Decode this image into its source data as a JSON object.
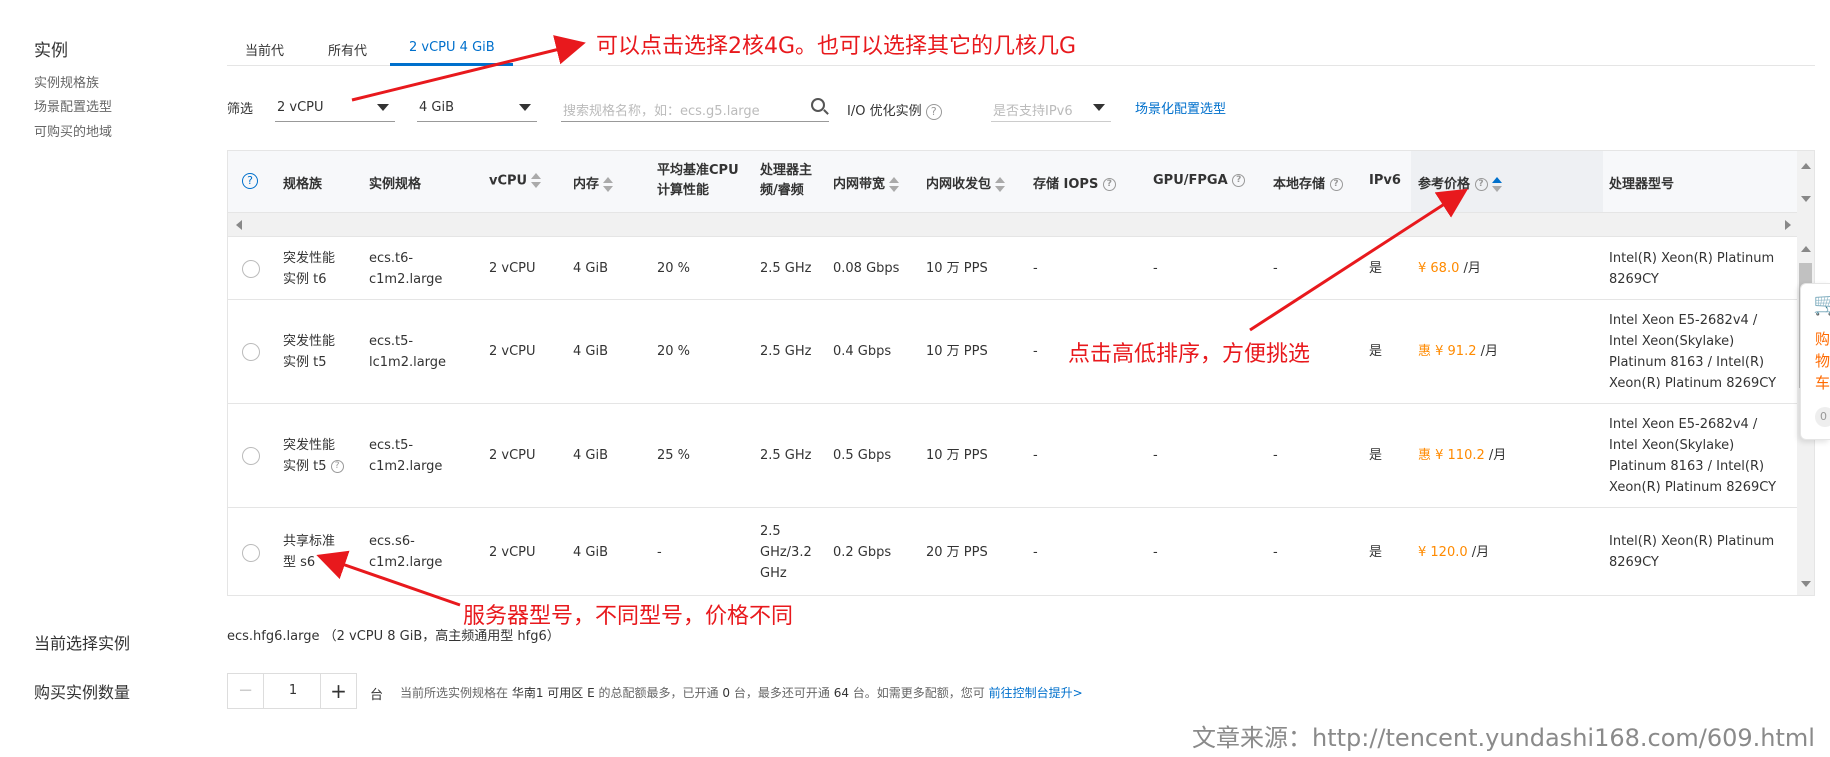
{
  "left_nav": {
    "title": "实例",
    "items": [
      "实例规格族",
      "场景配置选型",
      "可购买的地域"
    ]
  },
  "tabs": [
    "当前代",
    "所有代",
    "2 vCPU 4 GiB"
  ],
  "filter": {
    "label": "筛选",
    "cpu": "2 vCPU",
    "mem": "4 GiB",
    "search_placeholder": "搜索规格名称，如：ecs.g5.large",
    "io_label": "I/O 优化实例",
    "ipv6_placeholder": "是否支持IPv6",
    "scene_link": "场景化配置选型"
  },
  "table": {
    "headers": {
      "family": "规格族",
      "spec": "实例规格",
      "vcpu": "vCPU",
      "mem": "内存",
      "baseline": [
        "平均基准CPU",
        "计算性能"
      ],
      "freq": [
        "处理器主",
        "频/睿频"
      ],
      "bandwidth": "内网带宽",
      "pps": "内网收发包",
      "iops": "存储 IOPS",
      "gpu": "GPU/FPGA",
      "local": "本地存储",
      "ipv6": "IPv6",
      "price": "参考价格",
      "cpu_model": "处理器型号"
    },
    "rows": [
      {
        "family": [
          "突发性能",
          "实例 t6"
        ],
        "spec": [
          "ecs.t6-",
          "c1m2.large"
        ],
        "vcpu": "2 vCPU",
        "mem": "4 GiB",
        "baseline": "20 %",
        "freq": [
          "2.5 GHz"
        ],
        "bandwidth": "0.08 Gbps",
        "pps": "10 万 PPS",
        "iops": "-",
        "gpu": "-",
        "local": "-",
        "ipv6": "是",
        "price": "¥ 68.0",
        "unit": "/月",
        "cpu_model": [
          "Intel(R) Xeon(R) Platinum",
          "8269CY"
        ]
      },
      {
        "family": [
          "突发性能",
          "实例 t5"
        ],
        "spec": [
          "ecs.t5-",
          "lc1m2.large"
        ],
        "vcpu": "2 vCPU",
        "mem": "4 GiB",
        "baseline": "20 %",
        "freq": [
          "2.5 GHz"
        ],
        "bandwidth": "0.4 Gbps",
        "pps": "10 万 PPS",
        "iops": "-",
        "gpu": "-",
        "local": "-",
        "ipv6": "是",
        "price": "惠 ¥ 91.2",
        "unit": "/月",
        "cpu_model": [
          "Intel Xeon E5-2682v4 /",
          "Intel Xeon(Skylake)",
          "Platinum 8163 / Intel(R)",
          "Xeon(R) Platinum 8269CY"
        ]
      },
      {
        "family": [
          "突发性能",
          "实例 t5"
        ],
        "spec": [
          "ecs.t5-",
          "c1m2.large"
        ],
        "vcpu": "2 vCPU",
        "mem": "4 GiB",
        "baseline": "25 %",
        "freq": [
          "2.5 GHz"
        ],
        "bandwidth": "0.5 Gbps",
        "pps": "10 万 PPS",
        "iops": "-",
        "gpu": "-",
        "local": "-",
        "ipv6": "是",
        "price": "惠 ¥ 110.2",
        "unit": "/月",
        "cpu_model": [
          "Intel Xeon E5-2682v4 /",
          "Intel Xeon(Skylake)",
          "Platinum 8163 / Intel(R)",
          "Xeon(R) Platinum 8269CY"
        ]
      },
      {
        "family": [
          "共享标准",
          "型 s6"
        ],
        "spec": [
          "ecs.s6-",
          "c1m2.large"
        ],
        "vcpu": "2 vCPU",
        "mem": "4 GiB",
        "baseline": "-",
        "freq": [
          "2.5",
          "GHz/3.2",
          "GHz"
        ],
        "bandwidth": "0.2 Gbps",
        "pps": "20 万 PPS",
        "iops": "-",
        "gpu": "-",
        "local": "-",
        "ipv6": "是",
        "price": "¥ 120.0",
        "unit": "/月",
        "cpu_model": [
          "Intel(R) Xeon(R) Platinum",
          "8269CY"
        ]
      }
    ]
  },
  "current": {
    "label": "当前选择实例",
    "value": "ecs.hfg6.large （2 vCPU 8 GiB，高主频通用型 hfg6）"
  },
  "quantity": {
    "label": "购买实例数量",
    "value": "1",
    "unit": "台",
    "note_prefix": "当前所选实例规格在",
    "region": "华南1 可用区 E",
    "note_mid1": "的总配额最多，已开通",
    "opened": "0",
    "note_mid2": "台，最多还可开通",
    "remain": "64",
    "note_mid3": "台。如需更多配额，您可",
    "link": "前往控制台提升>"
  },
  "cart": {
    "chars": [
      "购",
      "物",
      "车"
    ],
    "count": "0"
  },
  "annotations": {
    "top": "可以点击选择2核4G。也可以选择其它的几核几G",
    "sort": "点击高低排序，方便挑选",
    "model": "服务器型号，不同型号，价格不同"
  },
  "watermark": "文章来源：http://tencent.yundashi168.com/609.html",
  "colors": {
    "accent": "#0070cc",
    "price": "#ff8a00",
    "annotation": "#e8191d"
  }
}
